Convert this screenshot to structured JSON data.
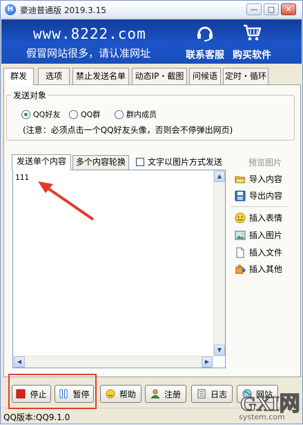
{
  "window": {
    "title": "豪迪普通版 2019.3.15",
    "app_icon_letter": "H"
  },
  "banner": {
    "url": "www.8222.com",
    "slogan": "假冒网站很多，请认准网址",
    "support_label": "联系客服",
    "buy_label": "购买软件"
  },
  "tabs": [
    "群发",
    "选项",
    "禁止发送名单",
    "动态IP・截图",
    "问候语",
    "定时・循环"
  ],
  "send_target": {
    "title": "发送对象",
    "options": [
      "QQ好友",
      "QQ群",
      "群内成员"
    ],
    "note": "(注意：必须点击一个QQ好友头像，否则会不停弹出网页)"
  },
  "content_tabs": [
    "发送单个内容",
    "多个内容轮换"
  ],
  "image_mode_label": "文字以图片方式发送",
  "editor_text": "111",
  "side": {
    "preview": "预览图片",
    "import": "导入内容",
    "export": "导出内容",
    "emoji": "插入表情",
    "image": "插入图片",
    "file": "插入文件",
    "other": "插入其他"
  },
  "buttons": {
    "stop": "停止",
    "pause": "暂停",
    "help": "帮助",
    "register": "注册",
    "log": "日志",
    "website": "网站"
  },
  "status": "QQ版本:QQ9.1.0",
  "watermark": {
    "brand": "GXI网",
    "domain": "system.com"
  },
  "colors": {
    "banner": "#1b55c9",
    "highlight_frame": "#e23b2e",
    "arrow": "#e23b2e"
  }
}
